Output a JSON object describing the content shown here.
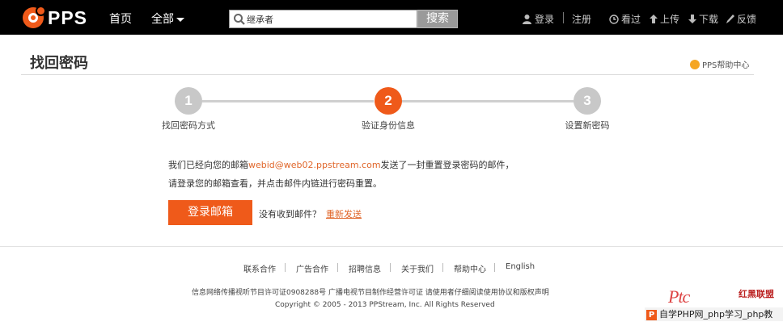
{
  "header": {
    "logo_text": "PPS",
    "nav_home": "首页",
    "nav_all": "全部",
    "search_value": "继承者",
    "search_button": "搜索",
    "login": "登录",
    "register": "注册",
    "history": "看过",
    "upload": "上传",
    "download": "下载",
    "feedback": "反馈"
  },
  "page": {
    "title": "找回密码",
    "help_link": "PPS帮助中心"
  },
  "steps": [
    {
      "number": "1",
      "label": "找回密码方式",
      "active": false
    },
    {
      "number": "2",
      "label": "验证身份信息",
      "active": true
    },
    {
      "number": "3",
      "label": "设置新密码",
      "active": false
    }
  ],
  "message": {
    "line1_prefix": "我们已经向您的邮箱",
    "email": "webid@web02.ppstream.com",
    "line1_suffix": "发送了一封重置登录密码的邮件，",
    "line2": "请登录您的邮箱查看，并点击邮件内链进行密码重置。",
    "login_button": "登录邮箱",
    "not_received": "没有收到邮件？",
    "resend": "重新发送"
  },
  "footer": {
    "links": [
      "联系合作",
      "广告合作",
      "招聘信息",
      "关于我们",
      "帮助中心",
      "English"
    ],
    "license": "信息网络传播视听节目许可证0908288号   广播电视节目制作经营许可证   请使用者仔细阅读使用协议和版权声明",
    "copyright": "Copyright © 2005 - 2013 PPStream, Inc. All Rights Reserved"
  },
  "watermark": {
    "logo": "Ptc",
    "red_text": "红黑联盟",
    "bar_text": "自学PHP网_php学习_php教"
  },
  "colors": {
    "accent": "#ef5a1a",
    "topbar": "#000000",
    "step_inactive": "#c8c8c8"
  }
}
